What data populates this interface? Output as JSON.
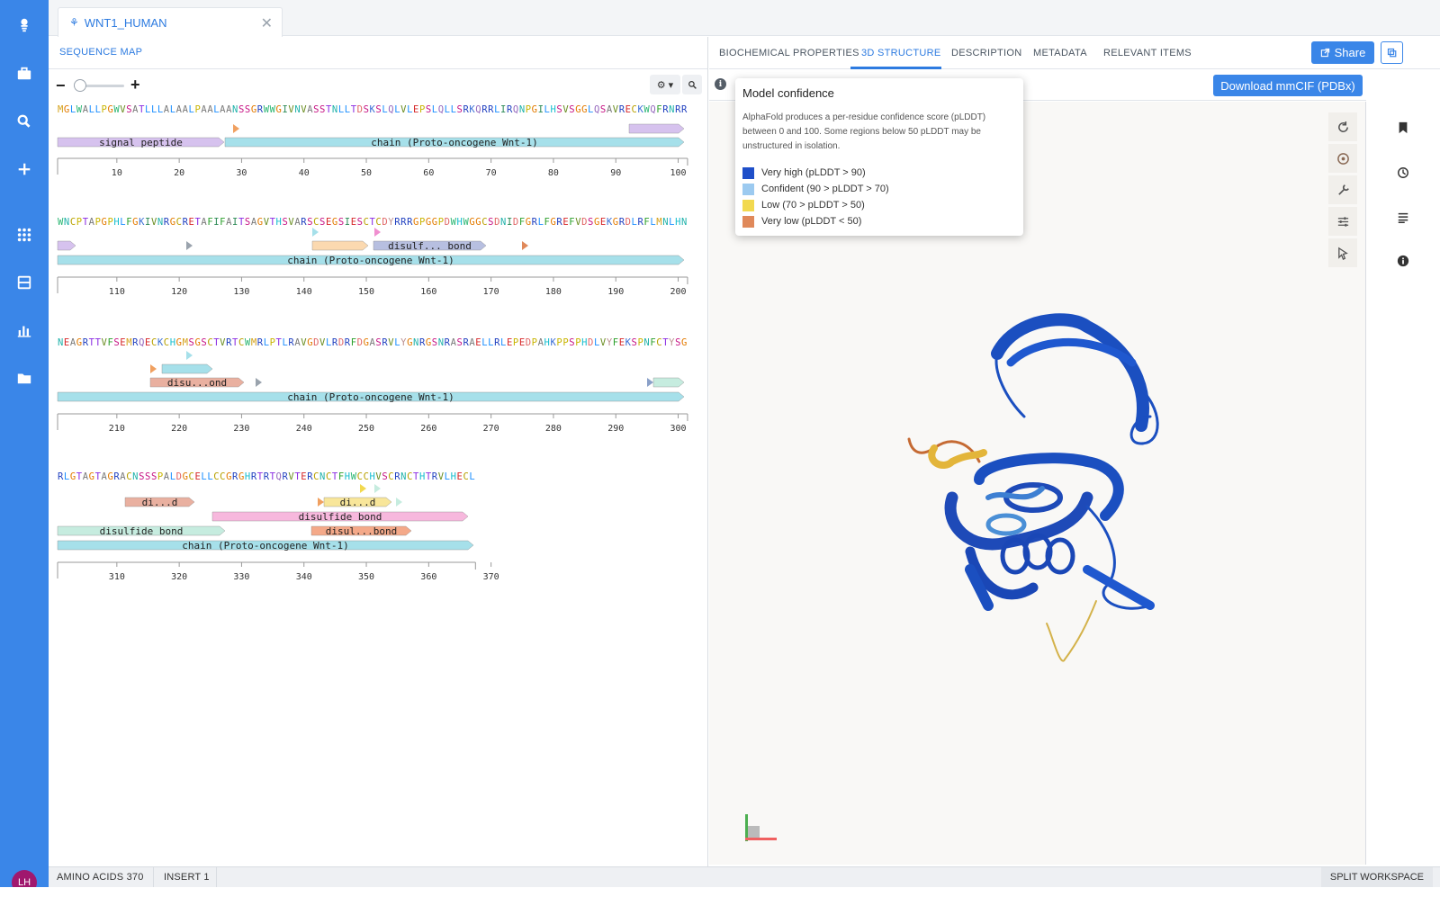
{
  "app": {
    "doc_tab_label": "WNT1_HUMAN",
    "avatar_initials": "LH",
    "brand_color": "#3a86e8"
  },
  "rail": {
    "icons": [
      "logo-icon",
      "briefcase-icon",
      "search-icon",
      "plus-icon",
      "apps-grid-icon",
      "registry-icon",
      "chart-icon",
      "folder-icon"
    ]
  },
  "left": {
    "tab_label": "SEQUENCE MAP",
    "zoom_minus": "−",
    "zoom_plus": "+",
    "settings_label": "⚙ ▾",
    "rows": [
      {
        "seq": "MGLWALLPGWVSATLLLALAALPAALAANSSGRWWGIVNVASSTNLLTDSKSLQLVLEPSLQLLSRKQRRLIRQNPGILHSVSGGLQSAVRECKWQFRNRR",
        "ticks": [
          "10",
          "20",
          "30",
          "40",
          "50",
          "60",
          "70",
          "80",
          "90",
          "100"
        ],
        "features": [
          "signal peptide",
          "chain (Proto-oncogene Wnt-1)"
        ]
      },
      {
        "seq": "WNCPTAPGPHLFGKIVNRGCRETAFIFAITSAGVTHSVARSCSEGSIESCTCDYRRRGPGGPDWHWGGCSDNIDFGRLFGREFVDSGEKGRDLRFLMNLHN",
        "ticks": [
          "110",
          "120",
          "130",
          "140",
          "150",
          "160",
          "170",
          "180",
          "190",
          "200"
        ],
        "features": [
          "disulf... bond",
          "chain (Proto-oncogene Wnt-1)"
        ]
      },
      {
        "seq": "NEAGRTTVFSEMRQECKCHGMSGSCTVRTCWMRLPTLRAVGDVLRDRFDGASRVLYGNRGSNRASRAELLRLEPEDPAHKPPSPHDLVYFEKSPNFCTYSG",
        "ticks": [
          "210",
          "220",
          "230",
          "240",
          "250",
          "260",
          "270",
          "280",
          "290",
          "300"
        ],
        "features": [
          "disu...ond",
          "chain (Proto-oncogene Wnt-1)"
        ]
      },
      {
        "seq": "RLGTAGTAGRACNSSSPALDGCELLCCGRGHRTRTQRVTERCNCTFHWCCHVSCRNCTHTRVLHECL",
        "ticks": [
          "310",
          "320",
          "330",
          "340",
          "350",
          "360",
          "370"
        ],
        "features": [
          "di...d",
          "di...d",
          "disulfide bond",
          "disulfide bond",
          "disul...bond",
          "chain (Proto-oncogene Wnt-1)"
        ]
      }
    ]
  },
  "right": {
    "tabs": [
      "BIOCHEMICAL PROPERTIES",
      "3D STRUCTURE",
      "DESCRIPTION",
      "METADATA",
      "RELEVANT ITEMS"
    ],
    "active_tab": "3D STRUCTURE",
    "share_label": "Share",
    "download_label": "Download mmCIF (PDBx)"
  },
  "tooltip": {
    "title": "Model confidence",
    "body": "AlphaFold produces a per-residue confidence score (pLDDT) between 0 and 100. Some regions below 50 pLDDT may be unstructured in isolation.",
    "legend": [
      {
        "label": "Very high (pLDDT > 90)",
        "color": "#1f4fc9"
      },
      {
        "label": "Confident (90 > pLDDT > 70)",
        "color": "#9ccaf0"
      },
      {
        "label": "Low (70 > pLDDT > 50)",
        "color": "#f2d94f"
      },
      {
        "label": "Very low (pLDDT < 50)",
        "color": "#e0895a"
      }
    ]
  },
  "status": {
    "amino_acids": "AMINO ACIDS 370",
    "insert": "INSERT 1",
    "split": "SPLIT WORKSPACE"
  },
  "aa_colors": {
    "M": "#d4a017",
    "G": "#e37b00",
    "L": "#1e90ff",
    "W": "#2bb673",
    "A": "#7a7a7a",
    "P": "#c8b400",
    "V": "#6b8e23",
    "S": "#c71585",
    "T": "#8a2be2",
    "N": "#20b2aa",
    "R": "#1f3fbf",
    "I": "#2e8b57",
    "E": "#d62728",
    "Q": "#9467bd",
    "D": "#e06666",
    "K": "#3b6fd6",
    "H": "#17becf",
    "C": "#b8a100",
    "F": "#2ca02c",
    "Y": "#bc8f8f"
  }
}
